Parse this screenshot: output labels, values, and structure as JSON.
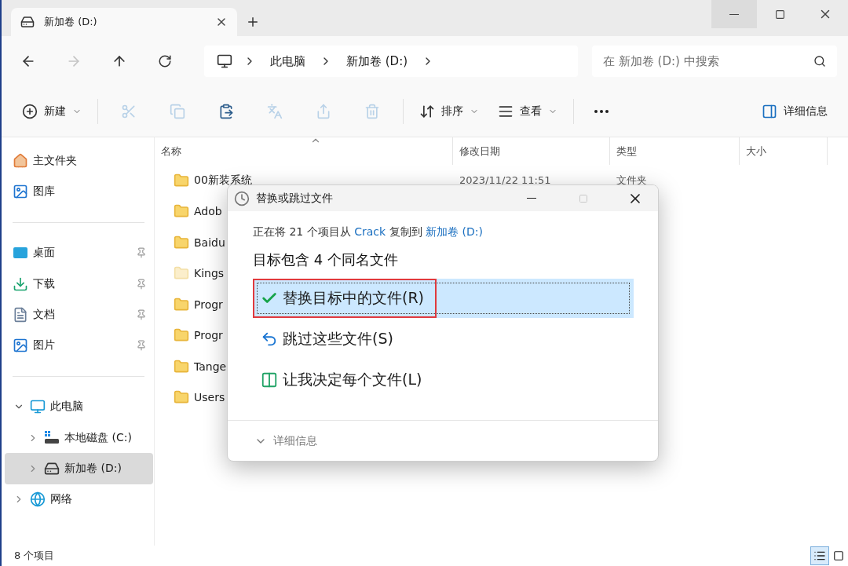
{
  "tab": {
    "title": "新加卷 (D:)"
  },
  "nav": {
    "back_disabled": false,
    "forward_disabled": true,
    "breadcrumb": [
      "此电脑",
      "新加卷 (D:)"
    ],
    "search": {
      "placeholder": "在 新加卷 (D:) 中搜索"
    }
  },
  "toolbar": {
    "new_label": "新建",
    "sort_label": "排序",
    "view_label": "查看",
    "details_label": "详细信息",
    "actions": [
      {
        "kind": "cut",
        "disabled": true
      },
      {
        "kind": "copy",
        "disabled": true
      },
      {
        "kind": "paste",
        "disabled": false
      },
      {
        "kind": "rename",
        "disabled": true
      },
      {
        "kind": "share",
        "disabled": true
      },
      {
        "kind": "delete",
        "disabled": true
      }
    ]
  },
  "sidebar": {
    "sections": [
      {
        "items": [
          {
            "kind": "home",
            "label": "主文件夹",
            "pinned": false,
            "selected": false
          },
          {
            "kind": "gallery",
            "label": "图库",
            "pinned": false,
            "selected": false
          }
        ]
      },
      {
        "items": [
          {
            "kind": "desktop",
            "label": "桌面",
            "pinned": true,
            "selected": false
          },
          {
            "kind": "downloads",
            "label": "下载",
            "pinned": true,
            "selected": false
          },
          {
            "kind": "documents",
            "label": "文档",
            "pinned": true,
            "selected": false
          },
          {
            "kind": "pictures",
            "label": "图片",
            "pinned": true,
            "selected": false
          }
        ]
      },
      {
        "items": [
          {
            "kind": "pc",
            "label": "此电脑",
            "pinned": false,
            "selected": false,
            "expanded": true,
            "children": [
              {
                "kind": "system-drive",
                "label": "本地磁盘 (C:)",
                "pinned": false,
                "selected": false,
                "expanded": false
              },
              {
                "kind": "drive",
                "label": "新加卷 (D:)",
                "pinned": false,
                "selected": true,
                "expanded": false
              }
            ]
          },
          {
            "kind": "network",
            "label": "网络",
            "pinned": false,
            "selected": false,
            "expanded": false
          }
        ]
      }
    ]
  },
  "table": {
    "columns": [
      "名称",
      "修改日期",
      "类型",
      "大小"
    ],
    "rows": [
      {
        "name": "00新装系统",
        "modified": "2023/11/22 11:51",
        "type": "文件夹",
        "hidden": false
      },
      {
        "name": "Adob",
        "hidden": false
      },
      {
        "name": "Baidu",
        "hidden": false
      },
      {
        "name": "Kings",
        "hidden": true
      },
      {
        "name": "Progr",
        "hidden": false
      },
      {
        "name": "Progr",
        "hidden": false
      },
      {
        "name": "Tange",
        "hidden": false
      },
      {
        "name": "Users",
        "hidden": false
      }
    ]
  },
  "status_bar": {
    "count": "8 个项目",
    "views": [
      {
        "kind": "details",
        "selected": true
      },
      {
        "kind": "tiles",
        "selected": false
      }
    ]
  },
  "dialog": {
    "title": "替换或跳过文件",
    "maximize_disabled": true,
    "message": [
      {
        "kind": "text",
        "text": "正在将 21 个项目从 "
      },
      {
        "kind": "link",
        "text": "Crack"
      },
      {
        "kind": "text",
        "text": " 复制到 "
      },
      {
        "kind": "link",
        "text": "新加卷 (D:)"
      }
    ],
    "heading": "目标包含 4 个同名文件",
    "options": [
      {
        "kind": "replace",
        "label": "替换目标中的文件(R)",
        "selected": true,
        "highlighted": true
      },
      {
        "kind": "skip",
        "label": "跳过这些文件(S)",
        "selected": false,
        "highlighted": false
      },
      {
        "kind": "decide",
        "label": "让我决定每个文件(L)",
        "selected": false,
        "highlighted": false
      }
    ],
    "details": {
      "label": "详细信息",
      "expanded": false
    }
  }
}
